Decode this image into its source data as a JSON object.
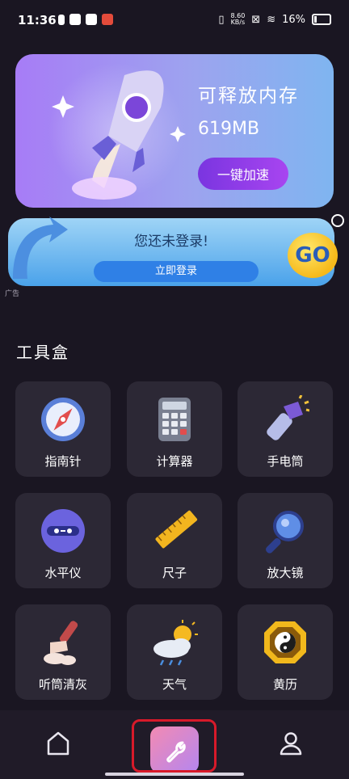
{
  "status_bar": {
    "time": "11:36",
    "net_speed_value": "8.60",
    "net_speed_unit": "KB/s",
    "battery": "16%"
  },
  "memory_card": {
    "title": "可释放内存",
    "value": "619MB",
    "button": "一键加速"
  },
  "login_banner": {
    "title": "您还未登录!",
    "button": "立即登录",
    "badge": "GO",
    "ad_label": "广告"
  },
  "toolbox": {
    "title": "工具盒",
    "items": [
      {
        "label": "指南针",
        "icon": "compass-icon"
      },
      {
        "label": "计算器",
        "icon": "calculator-icon"
      },
      {
        "label": "手电筒",
        "icon": "flashlight-icon"
      },
      {
        "label": "水平仪",
        "icon": "level-icon"
      },
      {
        "label": "尺子",
        "icon": "ruler-icon"
      },
      {
        "label": "放大镜",
        "icon": "magnifier-icon"
      },
      {
        "label": "听筒清灰",
        "icon": "brush-icon"
      },
      {
        "label": "天气",
        "icon": "weather-icon"
      },
      {
        "label": "黄历",
        "icon": "almanac-icon"
      }
    ]
  },
  "bottom_nav": {
    "items": [
      "home-icon",
      "tools-icon",
      "profile-icon"
    ],
    "active": "tools-icon"
  },
  "colors": {
    "background": "#1a1622",
    "tile": "#2c2835",
    "accent_purple": "#8a3de6",
    "login_blue": "#2f80e6",
    "highlight_red": "#d81a2a"
  }
}
